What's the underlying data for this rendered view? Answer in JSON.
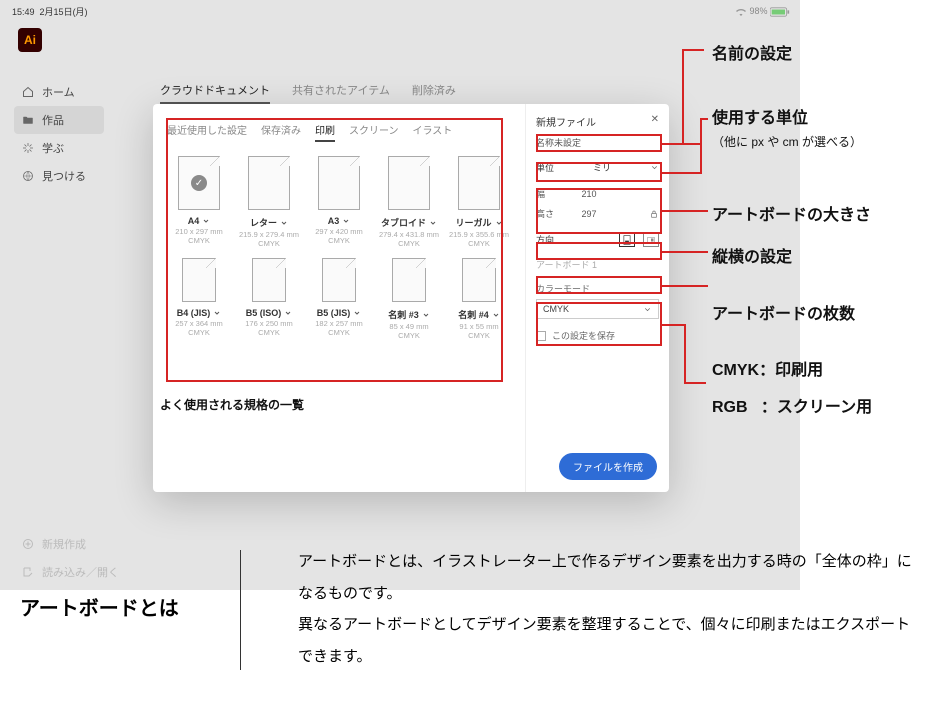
{
  "status": {
    "time": "15:49",
    "date": "2月15日(月)",
    "battery": "98%"
  },
  "ai_logo": "Ai",
  "sidebar": {
    "items": [
      {
        "label": "ホーム"
      },
      {
        "label": "作品"
      },
      {
        "label": "学ぶ"
      },
      {
        "label": "見つける"
      }
    ],
    "bottom": [
      {
        "label": "新規作成"
      },
      {
        "label": "読み込み／開く"
      }
    ]
  },
  "home_tabs": [
    "クラウドドキュメント",
    "共有されたアイテム",
    "削除済み"
  ],
  "modal": {
    "tabs": [
      "最近使用した設定",
      "保存済み",
      "印刷",
      "スクリーン",
      "イラスト"
    ],
    "active_tab_index": 2,
    "presets": [
      {
        "name": "A4",
        "dim": "210 x 297 mm",
        "mode": "CMYK",
        "selected": true
      },
      {
        "name": "レター",
        "dim": "215.9 x 279.4 mm",
        "mode": "CMYK"
      },
      {
        "name": "A3",
        "dim": "297 x 420 mm",
        "mode": "CMYK"
      },
      {
        "name": "タブロイド",
        "dim": "279.4 x 431.8 mm",
        "mode": "CMYK"
      },
      {
        "name": "リーガル",
        "dim": "215.9 x 355.6 mm",
        "mode": "CMYK"
      },
      {
        "name": "B4 (JIS)",
        "dim": "257 x 364 mm",
        "mode": "CMYK"
      },
      {
        "name": "B5 (ISO)",
        "dim": "176 x 250 mm",
        "mode": "CMYK"
      },
      {
        "name": "B5 (JIS)",
        "dim": "182 x 257 mm",
        "mode": "CMYK"
      },
      {
        "name": "名刺 #3",
        "dim": "85 x 49 mm",
        "mode": "CMYK"
      },
      {
        "name": "名刺 #4",
        "dim": "91 x 55 mm",
        "mode": "CMYK"
      }
    ],
    "caption": "よく使用される規格の一覧",
    "right": {
      "title": "新規ファイル",
      "name_value": "名称未設定",
      "unit_label": "単位",
      "unit_value": "ミリ",
      "width_label": "幅",
      "width_value": "210",
      "height_label": "高さ",
      "height_value": "297",
      "orient_label": "方向",
      "count_value": "アートボード 1",
      "cmode_label": "カラーモード",
      "cmode_value": "CMYK",
      "save_label": "この設定を保存",
      "create_label": "ファイルを作成"
    }
  },
  "annotations": {
    "name": "名前の設定",
    "unit": "使用する単位",
    "unit_sub": "（他に px や cm が選べる）",
    "size": "アートボードの大きさ",
    "orient": "縦横の設定",
    "count": "アートボードの枚数",
    "cmode1": "CMYK：印刷用",
    "cmode2": "RGB   ：スクリーン用"
  },
  "explain": {
    "title": "アートボードとは",
    "body": "アートボードとは、イラストレーター上で作るデザイン要素を出力する時の「全体の枠」になるものです。\n 異なるアートボードとしてデザイン要素を整理することで、個々に印刷またはエクスポートできます。"
  }
}
